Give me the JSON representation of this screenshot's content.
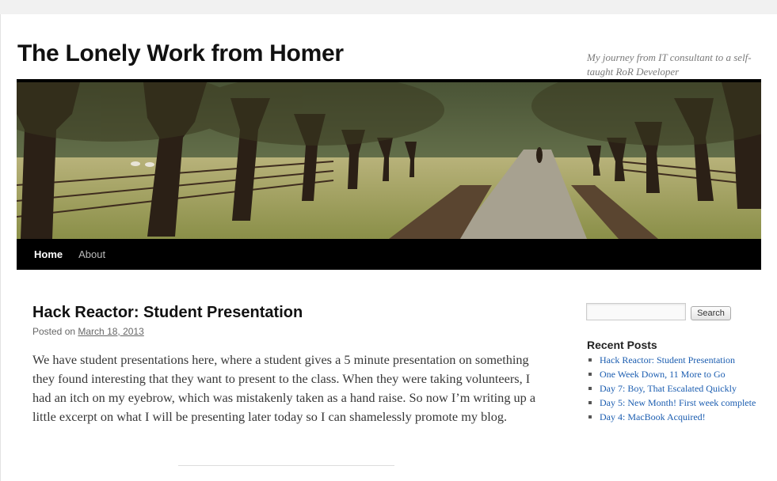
{
  "site": {
    "title": "The Lonely Work from Homer",
    "description": "My journey from IT consultant to a self-taught RoR Developer"
  },
  "nav": {
    "items": [
      {
        "label": "Home",
        "current": true
      },
      {
        "label": "About",
        "current": false
      }
    ]
  },
  "post": {
    "title": "Hack Reactor: Student Presentation",
    "posted_on_prefix": "Posted on",
    "date": "March 18, 2013",
    "body": "We have student presentations here, where a student gives a 5 minute presentation on something they found interesting that they want to present to the class.  When they were taking volunteers, I had an itch on my eyebrow, which was mistakenly taken as a hand raise.  So now I’m writing up a little excerpt on what I will be presenting later today so I can shamelessly promote my blog."
  },
  "sidebar": {
    "search": {
      "placeholder": "",
      "button_label": "Search"
    },
    "recent_posts": {
      "title": "Recent Posts",
      "items": [
        {
          "label": "Hack Reactor: Student Presentation"
        },
        {
          "label": "One Week Down, 11 More to Go"
        },
        {
          "label": "Day 7: Boy, That Escalated Quickly"
        },
        {
          "label": "Day 5: New Month! First week complete"
        },
        {
          "label": "Day 4: MacBook Acquired!"
        }
      ]
    }
  },
  "colors": {
    "nav_bg": "#000000",
    "link": "#1b5db0",
    "page_bg": "#f1f1f1"
  }
}
